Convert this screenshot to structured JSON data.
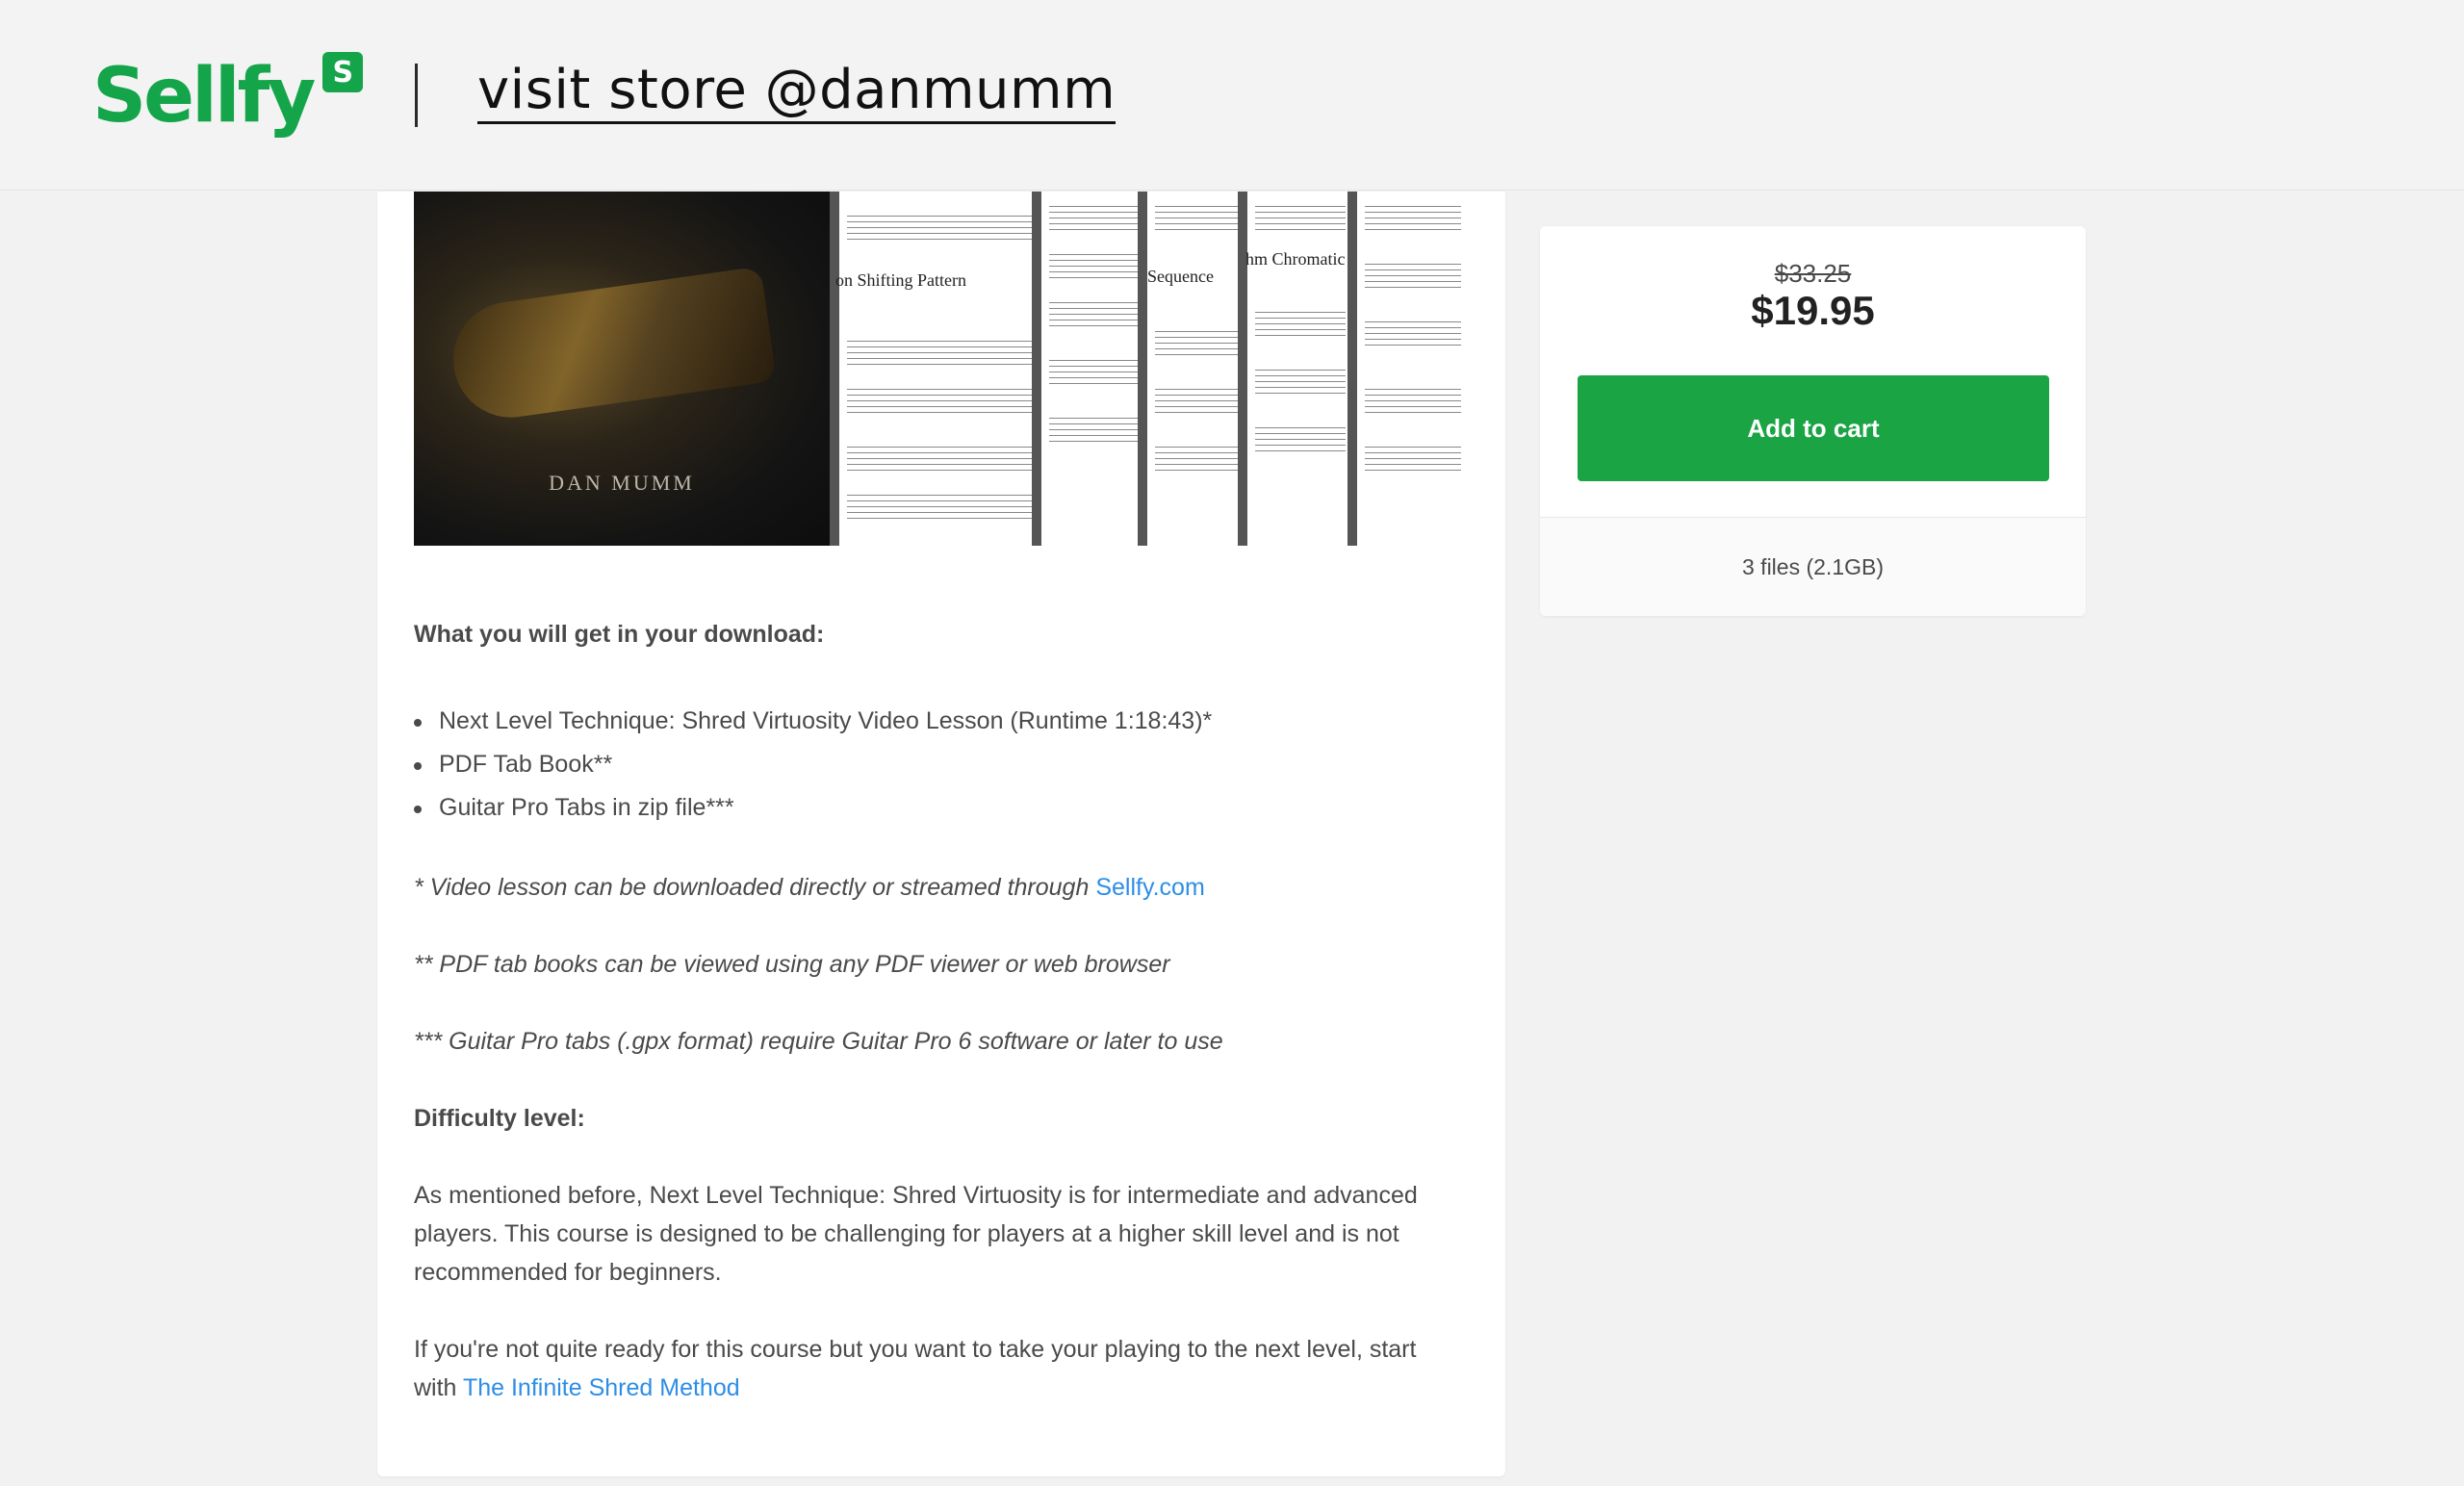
{
  "header": {
    "logo_text": "Sellfy",
    "logo_badge": "S",
    "store_link": "visit store @danmumm",
    "brand_color": "#14a54a"
  },
  "cover": {
    "album_name": "DAN MUMM",
    "captions": [
      "on Shifting Pattern",
      "Sequence",
      "hm Chromatic"
    ]
  },
  "description": {
    "download_heading": "What you will get in your download:",
    "items": [
      "Next Level Technique: Shred Virtuosity Video Lesson (Runtime 1:18:43)*",
      "PDF Tab Book**",
      "Guitar Pro Tabs in zip file***"
    ],
    "note1_text": "* Video lesson can be downloaded directly or streamed through ",
    "note1_link": "Sellfy.com",
    "note2": "** PDF tab books can be viewed using any PDF viewer or web browser",
    "note3": "*** Guitar Pro tabs (.gpx format) require Guitar Pro 6 software or later to use",
    "difficulty_heading": "Difficulty level:",
    "difficulty_text": "As mentioned before, Next Level Technique: Shred Virtuosity is for intermediate and advanced players.  This course is designed to be challenging for players at a higher skill level and is not recommended for beginners.",
    "closing_text": "If you're not quite ready for this course but you want to take your playing to the next level, start with ",
    "closing_link": "The Infinite Shred Method"
  },
  "buy_box": {
    "old_price": "$33.25",
    "new_price": "$19.95",
    "add_to_cart": "Add to cart",
    "files_info": "3 files (2.1GB)",
    "button_color": "#1aa444"
  }
}
